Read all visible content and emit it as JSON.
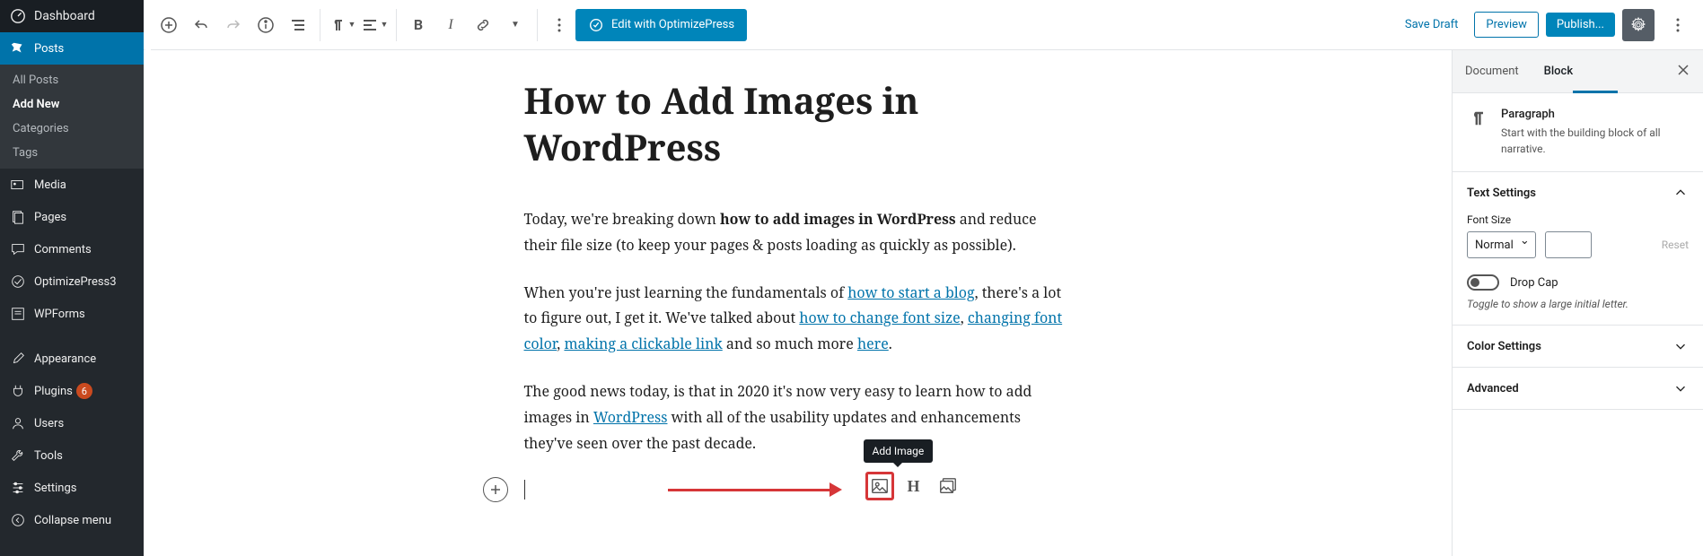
{
  "sidebar": {
    "dashboard": "Dashboard",
    "posts": "Posts",
    "posts_sub": [
      "All Posts",
      "Add New",
      "Categories",
      "Tags"
    ],
    "media": "Media",
    "pages": "Pages",
    "comments": "Comments",
    "op3": "OptimizePress3",
    "wpforms": "WPForms",
    "appearance": "Appearance",
    "plugins": "Plugins",
    "plugins_badge": "6",
    "users": "Users",
    "tools": "Tools",
    "settings": "Settings",
    "collapse": "Collapse menu"
  },
  "toolbar": {
    "edit_op": "Edit with OptimizePress",
    "save_draft": "Save Draft",
    "preview": "Preview",
    "publish": "Publish..."
  },
  "post": {
    "title": "How to Add Images in WordPress",
    "p1_a": "Today, we're breaking down ",
    "p1_b": "how to add images in WordPress",
    "p1_c": " and reduce their file size (to keep your pages & posts loading as quickly as possible).",
    "p2_a": "When you're just learning the fundamentals of ",
    "p2_l1": "how to start a blog",
    "p2_b": ", there's a lot to figure out, I get it. We've talked about ",
    "p2_l2": "how to change font size",
    "p2_c": ", ",
    "p2_l3": "changing font color",
    "p2_d": ", ",
    "p2_l4": "making a clickable link",
    "p2_e": " and so much more ",
    "p2_l5": "here",
    "p2_f": ".",
    "p3_a": "The good news today, is that in 2020 it's now very easy to learn how to add images in ",
    "p3_l1": "WordPress",
    "p3_b": " with all of the usability updates and enhancements they've seen over the past decade.",
    "tooltip": "Add Image"
  },
  "panel": {
    "tab_doc": "Document",
    "tab_block": "Block",
    "block_title": "Paragraph",
    "block_desc": "Start with the building block of all narrative.",
    "text_settings": "Text Settings",
    "font_size": "Font Size",
    "font_size_val": "Normal",
    "reset": "Reset",
    "drop_cap": "Drop Cap",
    "drop_cap_hint": "Toggle to show a large initial letter.",
    "color_settings": "Color Settings",
    "advanced": "Advanced"
  }
}
